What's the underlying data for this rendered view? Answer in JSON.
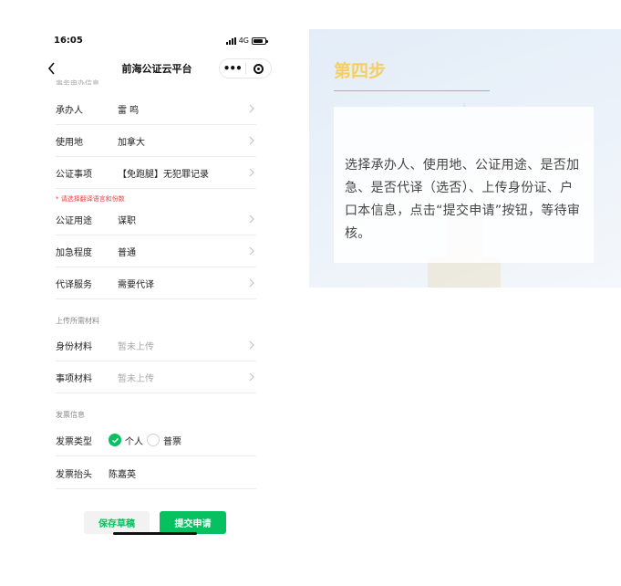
{
  "status_bar": {
    "time": "16:05",
    "network": "4G"
  },
  "nav": {
    "title": "前海公证云平台",
    "more": "•••"
  },
  "sections": {
    "applicant_info_cut": "事务申办信息",
    "upload": "上传所需材料",
    "invoice": "发票信息"
  },
  "rows": {
    "handler": {
      "label": "承办人",
      "value": "雷 鸣"
    },
    "use_place": {
      "label": "使用地",
      "value": "加拿大"
    },
    "matter": {
      "label": "公证事项",
      "value": "【免跑腿】无犯罪记录"
    },
    "purpose": {
      "label": "公证用途",
      "value": "谋职"
    },
    "urgency": {
      "label": "加急程度",
      "value": "普通"
    },
    "translate": {
      "label": "代译服务",
      "value": "需要代译"
    },
    "id_docs": {
      "label": "身份材料",
      "value": "暂未上传"
    },
    "matter_docs": {
      "label": "事项材料",
      "value": "暂未上传"
    },
    "invoice_type": {
      "label": "发票类型",
      "option_personal": "个人",
      "option_normal": "普票",
      "selected": "个人"
    },
    "invoice_header": {
      "label": "发票抬头",
      "value": "陈嘉英"
    }
  },
  "hint": "* 请选择翻译语言和份数",
  "buttons": {
    "save_draft": "保存草稿",
    "submit": "提交申请"
  },
  "panel": {
    "step_title": "第四步",
    "description": "选择承办人、使用地、公证用途、是否加急、是否代译（选否）、上传身份证、户口本信息，点击“提交申请”按钮，等待审核。"
  },
  "colors": {
    "accent_green": "#07c160",
    "hint_red": "#e64340",
    "step_title": "#f6cf63",
    "panel_bg": "#e3edf8"
  },
  "icons": [
    "back-icon",
    "menu-more-icon",
    "target-icon",
    "chevron-right-icon",
    "radio-checked-icon",
    "radio-unchecked-icon",
    "battery-icon",
    "signal-icon"
  ]
}
